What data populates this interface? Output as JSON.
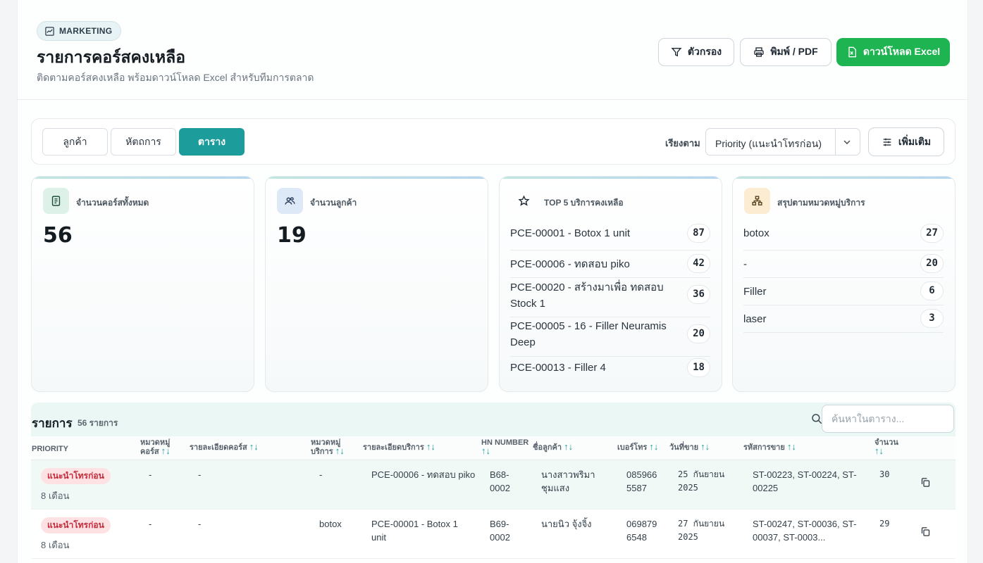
{
  "header": {
    "badge": "MARKETING",
    "title": "รายการคอร์สคงเหลือ",
    "subtitle": "ติดตามคอร์สคงเหลือ พร้อมดาวน์โหลด Excel สำหรับทีมการตลาด",
    "filter_label": "ตัวกรอง",
    "print_label": "พิมพ์ / PDF",
    "excel_label": "ดาวน์โหลด Excel"
  },
  "toolbar": {
    "tabs": [
      {
        "label": "ลูกค้า"
      },
      {
        "label": "หัตถการ"
      },
      {
        "label": "ตาราง"
      }
    ],
    "sort_label": "เรียงตาม",
    "sort_value": "Priority (แนะนำโทรก่อน)",
    "more_label": "เพิ่มเติม"
  },
  "cards": {
    "total_courses": {
      "title": "จำนวนคอร์สทั้งหมด",
      "value": "56"
    },
    "total_customers": {
      "title": "จำนวนลูกค้า",
      "value": "19"
    },
    "top5": {
      "title": "TOP 5 บริการคงเหลือ",
      "items": [
        {
          "label": "PCE-00001 - Botox 1 unit",
          "count": "87"
        },
        {
          "label": "PCE-00006 - ทดสอบ piko",
          "count": "42"
        },
        {
          "label": "PCE-00020 - สร้างมาเพื่อ ทดสอบ Stock 1",
          "count": "36"
        },
        {
          "label": "PCE-00005 - 16 - Filler Neuramis Deep",
          "count": "20"
        },
        {
          "label": "PCE-00013 - Filler 4",
          "count": "18"
        }
      ]
    },
    "categories": {
      "title": "สรุปตามหมวดหมู่บริการ",
      "items": [
        {
          "label": "botox",
          "count": "27"
        },
        {
          "label": "-",
          "count": "20"
        },
        {
          "label": "Filler",
          "count": "6"
        },
        {
          "label": "laser",
          "count": "3"
        }
      ]
    }
  },
  "table": {
    "title": "รายการ",
    "count": "56 รายการ",
    "search_placeholder": "ค้นหาในตาราง...",
    "columns": {
      "priority": "PRIORITY",
      "course_cat_1": "หมวดหมู่",
      "course_cat_2": "คอร์ส",
      "course_detail": "รายละเอียดคอร์ส",
      "service_cat_1": "หมวดหมู่",
      "service_cat_2": "บริการ",
      "service_detail": "รายละเอียดบริการ",
      "hn": "HN NUMBER",
      "customer": "ชื่อลูกค้า",
      "phone": "เบอร์โทร",
      "date": "วันที่ขาย",
      "sale_code": "รหัสการขาย",
      "qty": "จำนวน"
    },
    "rows": [
      {
        "priority": "แนะนำโทรก่อน",
        "months": "8 เดือน",
        "course_cat": "-",
        "course_detail": "-",
        "service_cat": "-",
        "service_detail": "PCE-00006 - ทดสอบ piko",
        "hn_1": "B68-",
        "hn_2": "0002",
        "customer_1": "นางสาวพริมา",
        "customer_2": "ชุมแสง",
        "phone_1": "085966",
        "phone_2": "5587",
        "date_1": "25 กันยายน",
        "date_2": "2025",
        "sale_1": "ST-00223, ST-00224, ST-",
        "sale_2": "00225",
        "qty": "30"
      },
      {
        "priority": "แนะนำโทรก่อน",
        "months": "8 เดือน",
        "course_cat": "-",
        "course_detail": "-",
        "service_cat": "botox",
        "service_detail_1": "PCE-00001 - Botox 1",
        "service_detail_2": "unit",
        "hn_1": "B69-",
        "hn_2": "0002",
        "customer_1": "นายนิว จุ้งจิ้ง",
        "phone_1": "069879",
        "phone_2": "6548",
        "date_1": "27 กันยายน",
        "date_2": "2025",
        "sale_1": "ST-00247, ST-00036, ST-",
        "sale_2": "00037, ST-0003...",
        "qty": "29"
      }
    ]
  },
  "sort_icon": "↑↓",
  "colors": {
    "accent": "#1d9c9c",
    "excel": "#1fb452",
    "priority_bg": "#fde1e3",
    "priority_text": "#c42a3a"
  }
}
